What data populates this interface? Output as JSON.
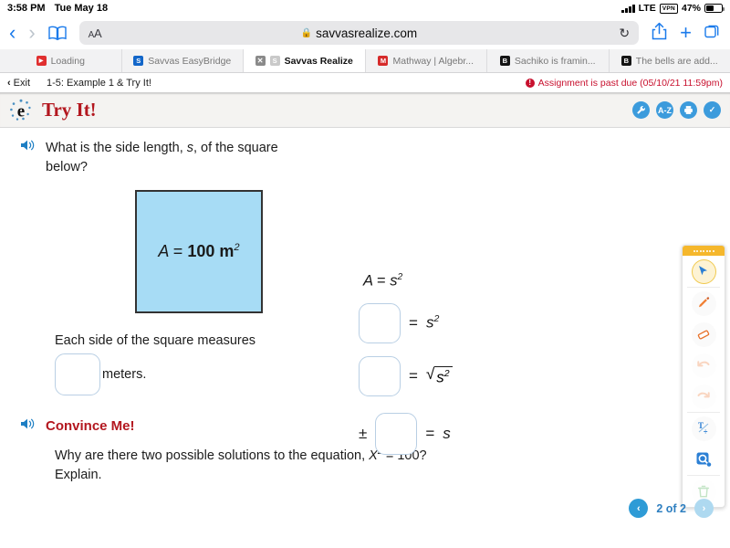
{
  "status_bar": {
    "time": "3:58 PM",
    "date": "Tue May 18",
    "network": "LTE",
    "vpn": "VPN",
    "battery": "47%"
  },
  "browser": {
    "back_icon": "chevron-left-icon",
    "forward_icon": "chevron-right-icon",
    "bookmarks_icon": "book-icon",
    "text_size_label": "AA",
    "url": "savvasrealize.com",
    "lock_icon": "lock-icon",
    "reload_icon": "reload-icon",
    "share_icon": "share-icon",
    "new_tab_icon": "plus-icon",
    "tabs_icon": "tabs-icon",
    "tabs": [
      {
        "label": "Loading",
        "favicon": "youtube-icon",
        "active": false,
        "closable": false
      },
      {
        "label": "Savvas EasyBridge",
        "favicon": "easybridge-icon",
        "active": false,
        "closable": false
      },
      {
        "label": "Savvas Realize",
        "favicon": "realize-icon",
        "active": true,
        "closable": true,
        "close_label": "✕"
      },
      {
        "label": "Mathway | Algebr...",
        "favicon": "mathway-icon",
        "active": false,
        "closable": false
      },
      {
        "label": "Sachiko is framin...",
        "favicon": "brainly-icon",
        "active": false,
        "closable": false
      },
      {
        "label": "The bells are add...",
        "favicon": "brainly-icon",
        "active": false,
        "closable": false
      }
    ]
  },
  "assignment_bar": {
    "exit_label": "Exit",
    "exit_chevron": "‹",
    "lesson_title": "1-5: Example 1 & Try It!",
    "past_due_text": "Assignment is past due (05/10/21 11:59pm)",
    "alert_mark": "!"
  },
  "tryit_header": {
    "logo": "savvas-e-logo",
    "title": "Try It!",
    "icons": [
      {
        "name": "tools-wrench-icon",
        "glyph": "🔧",
        "label": ""
      },
      {
        "name": "glossary-az-icon",
        "glyph": "",
        "label": "A-Z"
      },
      {
        "name": "print-icon",
        "glyph": "",
        "label": ""
      },
      {
        "name": "check-icon",
        "glyph": "✓",
        "label": ""
      }
    ]
  },
  "main": {
    "speaker_icon": "audio-speaker-icon",
    "question_line1": "What is the side length, ",
    "question_var": "s",
    "question_line1b": ", of the square",
    "question_line2": "below?",
    "figure": {
      "area_var": "A",
      "equals": "=",
      "area_value": "100 m",
      "area_exponent": "2",
      "fill_color": "#a7dcf5",
      "border_color": "#333333"
    },
    "equations": {
      "formula_var": "A",
      "formula_equals": "=",
      "formula_rhs": "s",
      "formula_exp": "2",
      "rows": [
        {
          "prefix": "",
          "blank": "",
          "operator": "=",
          "rhs": "s",
          "rhs_exp": "2",
          "radical": false
        },
        {
          "prefix": "",
          "blank": "",
          "operator": "=",
          "rhs": "s",
          "rhs_exp": "2",
          "radical": true
        },
        {
          "prefix": "±",
          "blank": "",
          "operator": "=",
          "rhs": "s",
          "rhs_exp": "",
          "radical": false
        }
      ]
    },
    "measures_text": "Each side of the square measures",
    "measures_blank_value": "",
    "measures_unit": "meters.",
    "convince": {
      "title": "Convince Me!",
      "question_a": "Why are there two possible solutions to the equation, ",
      "question_var": "X",
      "question_exp": "2",
      "question_b": " = 100?",
      "question_line2": "Explain."
    }
  },
  "draw_toolbar": {
    "handle": "drag-handle",
    "tools": [
      {
        "name": "pointer-tool",
        "selected": true,
        "faded": false
      },
      {
        "name": "pencil-tool",
        "selected": false,
        "faded": false
      },
      {
        "name": "eraser-tool",
        "selected": false,
        "faded": false
      },
      {
        "name": "undo-tool",
        "selected": false,
        "faded": true
      },
      {
        "name": "redo-tool",
        "selected": false,
        "faded": true
      },
      {
        "name": "math-text-tool",
        "selected": false,
        "faded": false
      },
      {
        "name": "zoom-tool",
        "selected": false,
        "faded": false
      },
      {
        "name": "trash-tool",
        "selected": false,
        "faded": true
      }
    ]
  },
  "pager": {
    "prev_glyph": "‹",
    "next_glyph": "›",
    "label": "2 of 2",
    "current_page": 2,
    "total_pages": 2
  }
}
